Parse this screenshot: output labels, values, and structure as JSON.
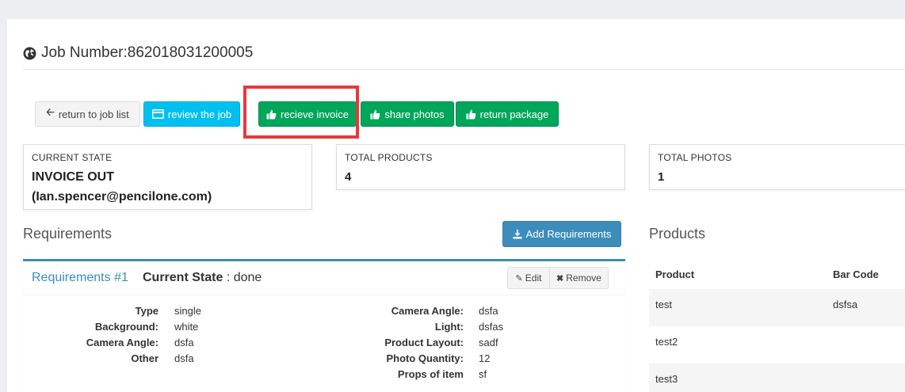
{
  "page": {
    "title": "Job Number:862018031200005"
  },
  "toolbar": {
    "return_label": "return to job list",
    "review_label": "review the job",
    "receive_label": "recieve invoice",
    "share_label": "share photos",
    "return_package_label": "return package"
  },
  "stats": {
    "current_state_label": "CURRENT STATE",
    "current_state_value": "INVOICE OUT",
    "current_state_user": "(Ian.spencer@pencilone.com)",
    "total_products_label": "TOTAL PRODUCTS",
    "total_products_value": "4",
    "total_photos_label": "TOTAL PHOTOS",
    "total_photos_value": "1"
  },
  "requirements": {
    "section_title": "Requirements",
    "add_label": "Add Requirements",
    "item": {
      "name": "Requirements #1",
      "state_label": "Current State",
      "state_value": ": done",
      "edit_label": "Edit",
      "remove_label": "Remove",
      "left": [
        {
          "label": "Type",
          "value": "single"
        },
        {
          "label": "Background:",
          "value": "white"
        },
        {
          "label": "Camera Angle:",
          "value": "dsfa"
        },
        {
          "label": "Other",
          "value": "dsfa"
        }
      ],
      "right": [
        {
          "label": "Camera Angle:",
          "value": "dsfa"
        },
        {
          "label": "Light:",
          "value": "dsfas"
        },
        {
          "label": "Product Layout:",
          "value": "sadf"
        },
        {
          "label": "Photo Quantity:",
          "value": "12"
        },
        {
          "label": "Props of item",
          "value": "sf"
        }
      ]
    }
  },
  "products": {
    "section_title": "Products",
    "columns": [
      "Product",
      "Bar Code"
    ],
    "rows": [
      [
        "test",
        "dsfsa"
      ],
      [
        "test2",
        ""
      ],
      [
        "test3",
        ""
      ]
    ]
  },
  "colors": {
    "primary": "#3c8dbc",
    "info": "#00c0ef",
    "success": "#00a65a",
    "highlight": "#e8383d"
  }
}
